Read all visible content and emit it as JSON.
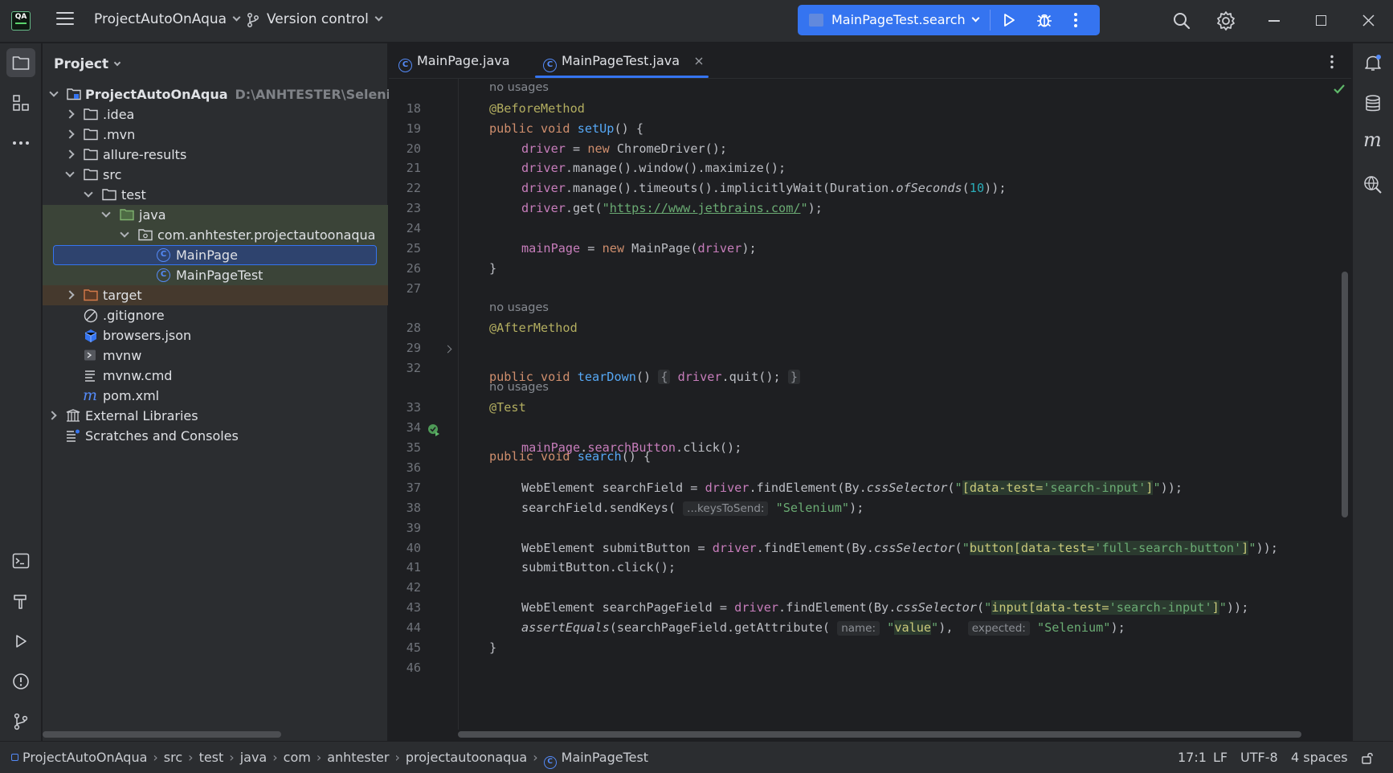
{
  "titlebar": {
    "project_name": "ProjectAutoOnAqua",
    "version_control": "Version control",
    "run_config": "MainPageTest.search",
    "logo_text": "QA"
  },
  "project_panel": {
    "title": "Project",
    "root": {
      "label": "ProjectAutoOnAqua",
      "path_hint": "D:\\ANHTESTER\\SeleniumJ"
    },
    "items": [
      {
        "label": ".idea"
      },
      {
        "label": ".mvn"
      },
      {
        "label": "allure-results"
      },
      {
        "label": "src"
      },
      {
        "label": "test"
      },
      {
        "label": "java"
      },
      {
        "label": "com.anhtester.projectautoonaqua"
      },
      {
        "label": "MainPage"
      },
      {
        "label": "MainPageTest"
      },
      {
        "label": "target"
      },
      {
        "label": ".gitignore"
      },
      {
        "label": "browsers.json"
      },
      {
        "label": "mvnw"
      },
      {
        "label": "mvnw.cmd"
      },
      {
        "label": "pom.xml"
      },
      {
        "label": "External Libraries"
      },
      {
        "label": "Scratches and Consoles"
      }
    ]
  },
  "editor": {
    "tabs": [
      {
        "label": "MainPage.java"
      },
      {
        "label": "MainPageTest.java"
      }
    ],
    "hint_no_usages": "no usages",
    "line_numbers": [
      "18",
      "19",
      "20",
      "21",
      "22",
      "23",
      "24",
      "25",
      "26",
      "27",
      "28",
      "29",
      "32",
      "33",
      "34",
      "35",
      "36",
      "37",
      "38",
      "39",
      "40",
      "41",
      "42",
      "43",
      "44",
      "45",
      "46"
    ],
    "code": {
      "l18": "@BeforeMethod",
      "l19_kw": "public void ",
      "l19_fn": "setUp",
      "l19_rest": "() {",
      "l20_fld": "driver",
      "l20_a": " = ",
      "l20_kw": "new ",
      "l20_b": "ChromeDriver();",
      "l21_fld": "driver",
      "l21_rest": ".manage().window().maximize();",
      "l22_fld": "driver",
      "l22_a": ".manage().timeouts().implicitlyWait(Duration.",
      "l22_it": "ofSeconds",
      "l22_b": "(",
      "l22_num": "10",
      "l22_c": "));",
      "l23_fld": "driver",
      "l23_a": ".get(",
      "l23_q1": "\"",
      "l23_url": "https://www.jetbrains.com/",
      "l23_q2": "\"",
      "l23_b": ");",
      "l25_fld": "mainPage",
      "l25_a": " = ",
      "l25_kw": "new ",
      "l25_b": "MainPage(",
      "l25_fld2": "driver",
      "l25_c": ");",
      "l26": "}",
      "l28": "@AfterMethod",
      "l29_kw": "public void ",
      "l29_fn": "tearDown",
      "l29_a": "() ",
      "l29_f1": "{",
      "l29_fld": "driver",
      "l29_b": ".quit();",
      "l29_f2": "}",
      "l33": "@Test",
      "l34_kw": "public void ",
      "l34_fn": "search",
      "l34_rest": "() {",
      "l35_fld": "mainPage",
      "l35_a": ".",
      "l35_fld2": "searchButton",
      "l35_b": ".click();",
      "l37_a": "WebElement searchField = ",
      "l37_fld": "driver",
      "l37_b": ".findElement(By.",
      "l37_it": "cssSelector",
      "l37_c": "(",
      "l37_str1": "\"",
      "l37_inj": "[data-test=",
      "l37_str2": "'search-input'",
      "l37_inj2": "]",
      "l37_str3": "\"",
      "l37_d": "));",
      "l38_a": "searchField.sendKeys( ",
      "l38_hint": "...keysToSend:",
      "l38_str": " \"Selenium\"",
      "l38_b": ");",
      "l40_a": "WebElement submitButton = ",
      "l40_fld": "driver",
      "l40_b": ".findElement(By.",
      "l40_it": "cssSelector",
      "l40_c": "(",
      "l40_str1": "\"",
      "l40_inj": "button[data-test=",
      "l40_str2": "'full-search-button'",
      "l40_inj2": "]",
      "l40_str3": "\"",
      "l40_d": "));",
      "l41": "submitButton.click();",
      "l43_a": "WebElement searchPageField = ",
      "l43_fld": "driver",
      "l43_b": ".findElement(By.",
      "l43_it": "cssSelector",
      "l43_c": "(",
      "l43_str1": "\"",
      "l43_inj": "input[data-test=",
      "l43_str2": "'search-input'",
      "l43_inj2": "]",
      "l43_str3": "\"",
      "l43_d": "));",
      "l44_it": "assertEquals",
      "l44_a": "(searchPageField.getAttribute( ",
      "l44_hint1": "name:",
      "l44_s1": " \"",
      "l44_val": "value",
      "l44_s2": "\"",
      "l44_b": "),  ",
      "l44_hint2": "expected:",
      "l44_s3": " \"Selenium\"",
      "l44_c": ");",
      "l45": "}"
    }
  },
  "statusbar": {
    "breadcrumbs": [
      "ProjectAutoOnAqua",
      "src",
      "test",
      "java",
      "com",
      "anhtester",
      "projectautoonaqua",
      "MainPageTest"
    ],
    "position": "17:1",
    "line_sep": "LF",
    "encoding": "UTF-8",
    "indent": "4 spaces"
  },
  "colors": {
    "accent": "#3574f0",
    "keyword": "#cf8e6d",
    "annotation": "#b3ae60",
    "string": "#6aab73",
    "field": "#c77dbb",
    "function": "#56a8f5"
  }
}
